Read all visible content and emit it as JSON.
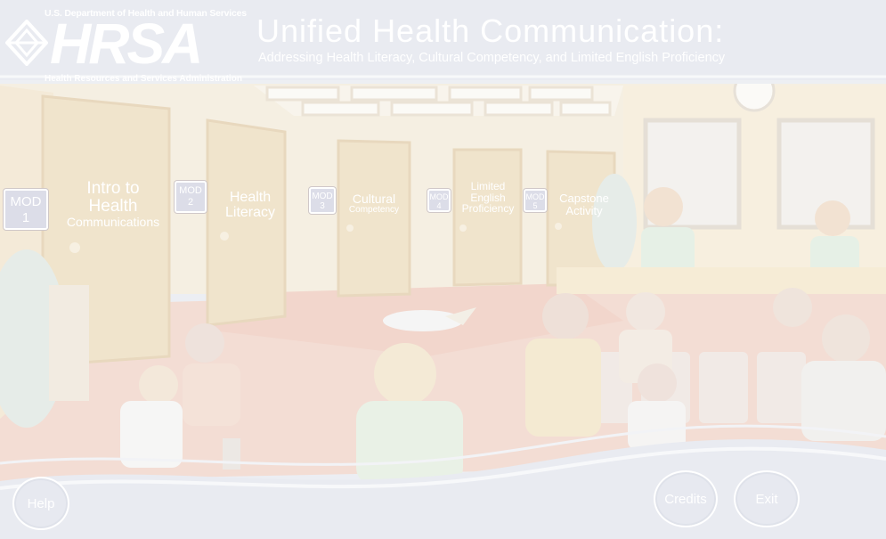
{
  "header": {
    "department": "U.S. Department of Health and Human Services",
    "logo_text": "HRSA",
    "administration": "Health Resources and Services Administration",
    "title": "Unified Health Communication:",
    "subtitle": "Addressing Health Literacy, Cultural Competency, and Limited English Proficiency"
  },
  "modules": [
    {
      "badge_line1": "MOD",
      "badge_line2": "1",
      "label_lines": [
        "Intro to",
        "Health",
        "Communications"
      ]
    },
    {
      "badge_line1": "MOD",
      "badge_line2": "2",
      "label_lines": [
        "Health",
        "Literacy"
      ]
    },
    {
      "badge_line1": "MOD",
      "badge_line2": "3",
      "label_lines": [
        "Cultural",
        "Competency"
      ]
    },
    {
      "badge_line1": "MOD",
      "badge_line2": "4",
      "label_lines": [
        "Limited",
        "English",
        "Proficiency"
      ]
    },
    {
      "badge_line1": "MOD",
      "badge_line2": "5",
      "label_lines": [
        "Capstone",
        "Activity"
      ]
    }
  ],
  "buttons": {
    "help": "Help",
    "credits": "Credits",
    "exit": "Exit"
  },
  "colors": {
    "wall": "#f6ecd6",
    "door": "#efe1c8",
    "floor": "#f0d8d0",
    "overlay": "#e9ebf1"
  }
}
